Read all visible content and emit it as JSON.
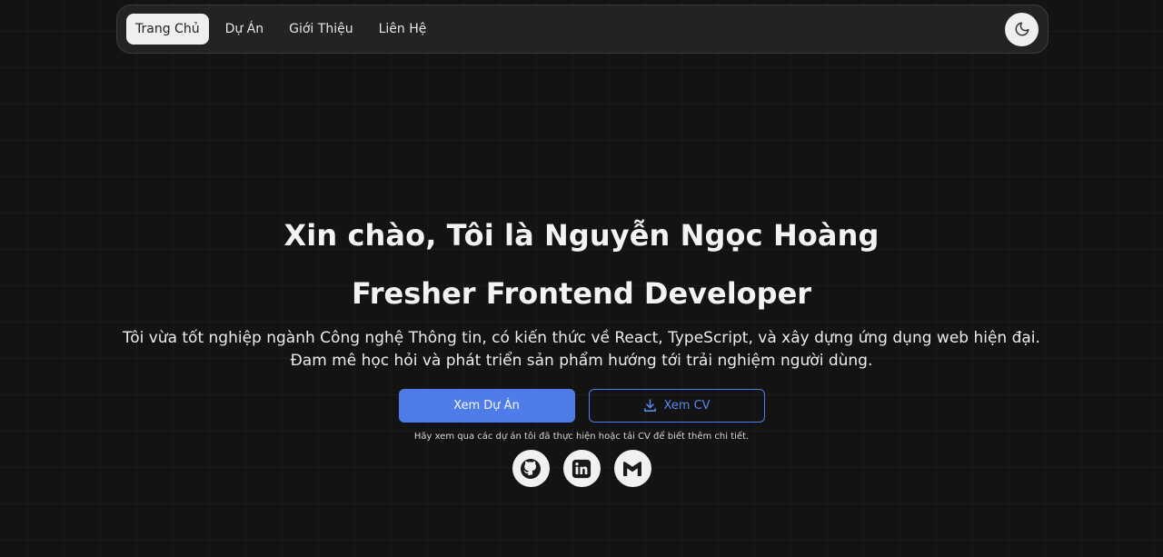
{
  "nav": {
    "items": [
      {
        "label": "Trang Chủ",
        "active": true
      },
      {
        "label": "Dự Án",
        "active": false
      },
      {
        "label": "Giới Thiệu",
        "active": false
      },
      {
        "label": "Liên Hệ",
        "active": false
      }
    ],
    "theme_icon": "moon-icon"
  },
  "hero": {
    "greeting": "Xin chào, Tôi là Nguyễn Ngọc Hoàng",
    "role": "Fresher Frontend Developer",
    "description": "Tôi vừa tốt nghiệp ngành Công nghệ Thông tin, có kiến thức về React, TypeScript, và xây dựng ứng dụng web hiện đại. Đam mê học hỏi và phát triển sản phẩm hướng tới trải nghiệm người dùng.",
    "primary_button": "Xem Dự Án",
    "cv_button": "Xem CV",
    "hint": "Hãy xem qua các dự án tôi đã thực hiện hoặc tải CV để biết thêm chi tiết."
  },
  "socials": [
    {
      "icon": "github-icon"
    },
    {
      "icon": "linkedin-icon"
    },
    {
      "icon": "gmail-icon"
    }
  ],
  "colors": {
    "accent": "#4f7ce8",
    "background": "#131313",
    "navbar": "#232323"
  }
}
